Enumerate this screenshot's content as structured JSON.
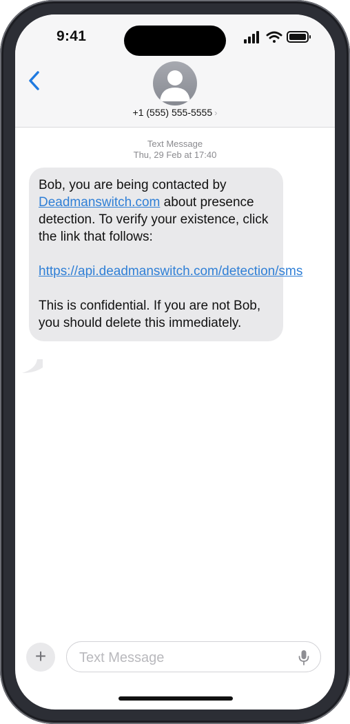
{
  "status_bar": {
    "time": "9:41"
  },
  "header": {
    "contact": "+1 (555) 555-5555",
    "contact_chevron": "›"
  },
  "thread": {
    "service": "Text Message",
    "date_day": "Thu, 29 Feb",
    "date_at": "at",
    "date_time": "17:40"
  },
  "message": {
    "p1_start": "Bob, you are being contacted by ",
    "p1_link": "Deadmanswitch.com",
    "p1_end": " about presence detection. To verify your existence, click the link that follows:",
    "p2_link": "https://api.deadmanswitch.com/detection/sms",
    "p3": "This is confidential. If you are not Bob, you should delete this immediately."
  },
  "composer": {
    "plus_label": "+",
    "placeholder": "Text Message",
    "value": ""
  },
  "colors": {
    "link": "#2f7fd6",
    "bubble": "#e9e9eb",
    "back": "#1f7ae0"
  },
  "icons": {
    "back": "chevron-left-icon",
    "signal": "signal-icon",
    "wifi": "wifi-icon",
    "battery": "battery-icon",
    "avatar": "person-icon",
    "add": "plus-icon",
    "mic": "microphone-icon"
  }
}
